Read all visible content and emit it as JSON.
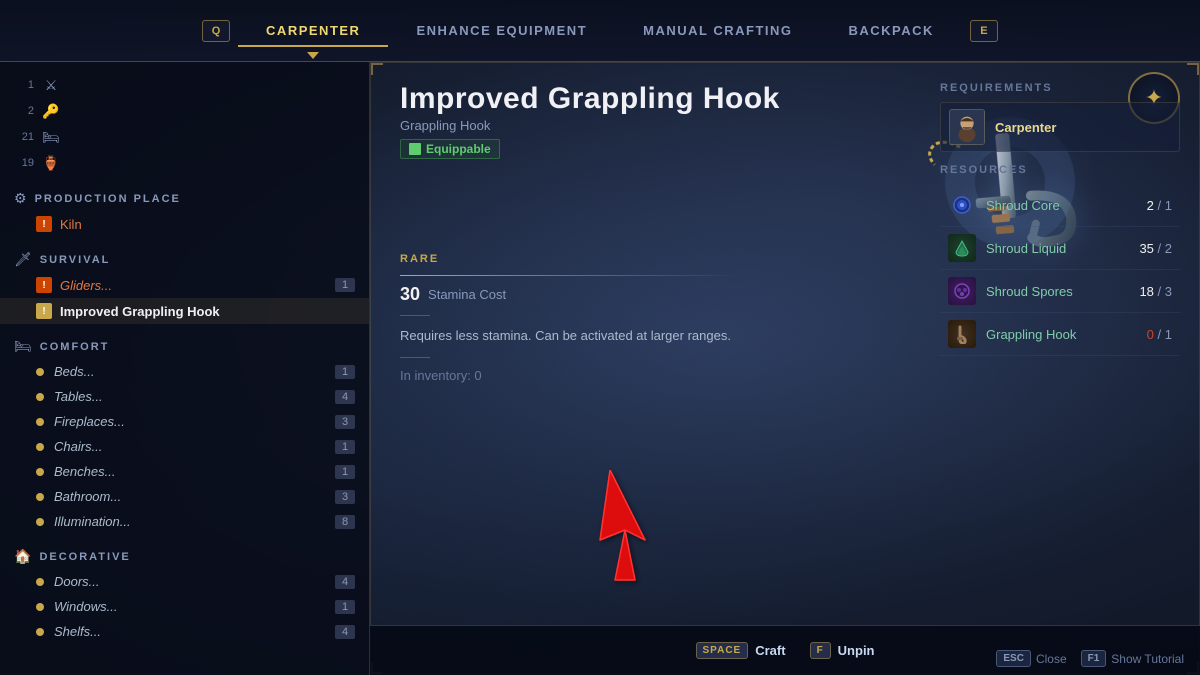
{
  "nav": {
    "key_left": "Q",
    "key_right": "E",
    "tabs": [
      {
        "id": "carpenter",
        "label": "CARPENTER",
        "active": true
      },
      {
        "id": "enhance",
        "label": "ENHANCE EQUIPMENT",
        "active": false
      },
      {
        "id": "manual",
        "label": "MANUAL CRAFTING",
        "active": false
      },
      {
        "id": "backpack",
        "label": "BACKPACK",
        "active": false
      }
    ]
  },
  "sidebar": {
    "player_items": [
      {
        "num": "1",
        "icon": "⚔"
      },
      {
        "num": "2",
        "icon": "🔑"
      },
      {
        "num": "21",
        "icon": "🛏"
      },
      {
        "num": "19",
        "icon": "🪣"
      }
    ],
    "sections": [
      {
        "id": "production",
        "title": "PRODUCTION PLACE",
        "icon": "⚙",
        "items": [
          {
            "id": "kiln",
            "label": "Kiln",
            "badge": "",
            "active": false,
            "warning": true,
            "italic": false,
            "orange": true
          }
        ]
      },
      {
        "id": "survival",
        "title": "SURVIVAL",
        "icon": "🗡",
        "items": [
          {
            "id": "gliders",
            "label": "Gliders...",
            "badge": "1",
            "active": false,
            "warning": true,
            "italic": true,
            "orange": true
          },
          {
            "id": "grappling",
            "label": "Improved Grappling Hook",
            "badge": "",
            "active": true,
            "warning": false,
            "italic": false,
            "orange": false
          }
        ]
      },
      {
        "id": "comfort",
        "title": "COMFORT",
        "icon": "🛏",
        "items": [
          {
            "id": "beds",
            "label": "Beds...",
            "badge": "1",
            "dot": true,
            "italic": true
          },
          {
            "id": "tables",
            "label": "Tables...",
            "badge": "4",
            "dot": true,
            "italic": true
          },
          {
            "id": "fireplaces",
            "label": "Fireplaces...",
            "badge": "3",
            "dot": true,
            "italic": true
          },
          {
            "id": "chairs",
            "label": "Chairs...",
            "badge": "1",
            "dot": true,
            "italic": true
          },
          {
            "id": "benches",
            "label": "Benches...",
            "badge": "1",
            "dot": true,
            "italic": true
          },
          {
            "id": "bathroom",
            "label": "Bathroom...",
            "badge": "3",
            "dot": true,
            "italic": true
          },
          {
            "id": "illumination",
            "label": "Illumination...",
            "badge": "8",
            "dot": true,
            "italic": true
          }
        ]
      },
      {
        "id": "decorative",
        "title": "DECORATIVE",
        "icon": "🏠",
        "items": [
          {
            "id": "doors",
            "label": "Doors...",
            "badge": "4",
            "dot": true,
            "italic": true
          },
          {
            "id": "windows",
            "label": "Windows...",
            "badge": "1",
            "dot": true,
            "italic": true
          },
          {
            "id": "shelfs",
            "label": "Shelfs...",
            "badge": "4",
            "dot": true,
            "italic": true
          }
        ]
      }
    ]
  },
  "item": {
    "title": "Improved Grappling Hook",
    "subtitle": "Grappling Hook",
    "equippable": "Equippable",
    "rarity": "RARE",
    "stamina_cost_num": "30",
    "stamina_cost_label": "Stamina Cost",
    "description": "Requires less stamina. Can be activated at larger ranges.",
    "inventory_label": "In inventory: 0"
  },
  "requirements": {
    "title": "REQUIREMENTS",
    "carpenter_label": "Carpenter",
    "resources_title": "RESOURCES",
    "resources": [
      {
        "id": "shroud_core",
        "name": "Shroud Core",
        "have": "2",
        "need": "1",
        "color": "blue",
        "icon": "💠",
        "lacking": false
      },
      {
        "id": "shroud_liquid",
        "name": "Shroud Liquid",
        "have": "35",
        "need": "2",
        "color": "green",
        "icon": "🟢",
        "lacking": false
      },
      {
        "id": "shroud_spores",
        "name": "Shroud Spores",
        "have": "18",
        "need": "3",
        "color": "purple",
        "icon": "🔵",
        "lacking": false
      },
      {
        "id": "grappling_hook",
        "name": "Grappling Hook",
        "have": "0",
        "need": "1",
        "color": "brown",
        "icon": "🪝",
        "lacking": true
      }
    ]
  },
  "bottom_bar": {
    "craft_key": "SPACE",
    "craft_label": "Craft",
    "unpin_key": "F",
    "unpin_label": "Unpin"
  },
  "controls": {
    "esc_label": "Close",
    "f1_label": "Show Tutorial"
  }
}
